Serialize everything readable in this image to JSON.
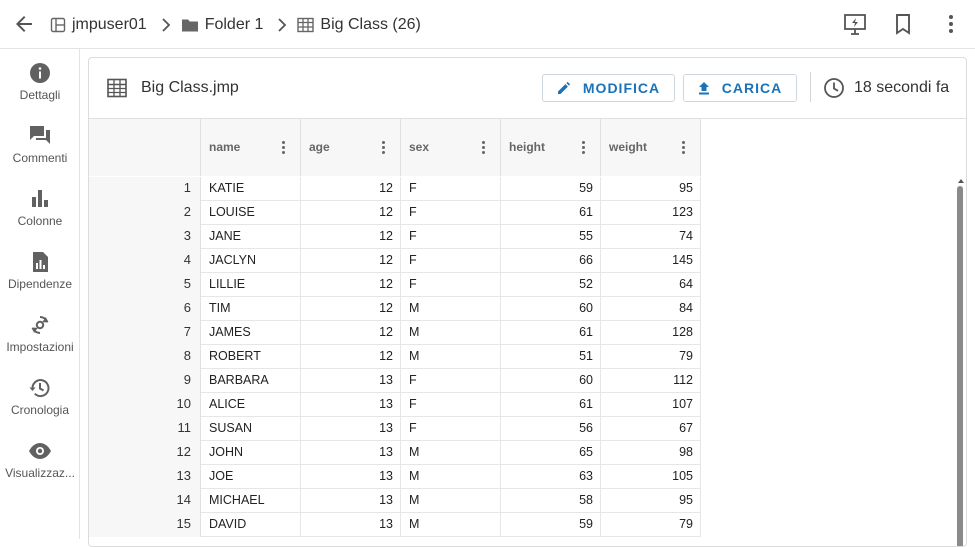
{
  "breadcrumb": {
    "items": [
      {
        "label": "jmpuser01",
        "icon": "workspace-icon"
      },
      {
        "label": "Folder 1",
        "icon": "folder-icon"
      },
      {
        "label": "Big Class (26)",
        "icon": "table-icon"
      }
    ]
  },
  "toolbar": {
    "icons": [
      "presentation-icon",
      "bookmark-icon",
      "more-vert-icon"
    ]
  },
  "sidebar": {
    "items": [
      {
        "label": "Dettagli",
        "icon": "info-icon"
      },
      {
        "label": "Commenti",
        "icon": "comments-icon"
      },
      {
        "label": "Colonne",
        "icon": "bar-chart-icon"
      },
      {
        "label": "Dipendenze",
        "icon": "file-chart-icon"
      },
      {
        "label": "Impostazioni",
        "icon": "settings-sync-icon"
      },
      {
        "label": "Cronologia",
        "icon": "history-icon"
      },
      {
        "label": "Visualizzaz...",
        "icon": "eye-icon"
      }
    ]
  },
  "file": {
    "title": "Big Class.jmp",
    "edit_label": "MODIFICA",
    "upload_label": "CARICA",
    "updated": "18 secondi fa"
  },
  "table": {
    "columns": [
      "name",
      "age",
      "sex",
      "height",
      "weight"
    ],
    "rows": [
      {
        "n": "1",
        "cells": [
          "KATIE",
          "12",
          "F",
          "59",
          "95"
        ]
      },
      {
        "n": "2",
        "cells": [
          "LOUISE",
          "12",
          "F",
          "61",
          "123"
        ]
      },
      {
        "n": "3",
        "cells": [
          "JANE",
          "12",
          "F",
          "55",
          "74"
        ]
      },
      {
        "n": "4",
        "cells": [
          "JACLYN",
          "12",
          "F",
          "66",
          "145"
        ]
      },
      {
        "n": "5",
        "cells": [
          "LILLIE",
          "12",
          "F",
          "52",
          "64"
        ]
      },
      {
        "n": "6",
        "cells": [
          "TIM",
          "12",
          "M",
          "60",
          "84"
        ]
      },
      {
        "n": "7",
        "cells": [
          "JAMES",
          "12",
          "M",
          "61",
          "128"
        ]
      },
      {
        "n": "8",
        "cells": [
          "ROBERT",
          "12",
          "M",
          "51",
          "79"
        ]
      },
      {
        "n": "9",
        "cells": [
          "BARBARA",
          "13",
          "F",
          "60",
          "112"
        ]
      },
      {
        "n": "10",
        "cells": [
          "ALICE",
          "13",
          "F",
          "61",
          "107"
        ]
      },
      {
        "n": "11",
        "cells": [
          "SUSAN",
          "13",
          "F",
          "56",
          "67"
        ]
      },
      {
        "n": "12",
        "cells": [
          "JOHN",
          "13",
          "M",
          "65",
          "98"
        ]
      },
      {
        "n": "13",
        "cells": [
          "JOE",
          "13",
          "M",
          "63",
          "105"
        ]
      },
      {
        "n": "14",
        "cells": [
          "MICHAEL",
          "13",
          "M",
          "58",
          "95"
        ]
      },
      {
        "n": "15",
        "cells": [
          "DAVID",
          "13",
          "M",
          "59",
          "79"
        ]
      }
    ]
  },
  "colors": {
    "accent": "#1a73b8",
    "icon": "#616161"
  }
}
